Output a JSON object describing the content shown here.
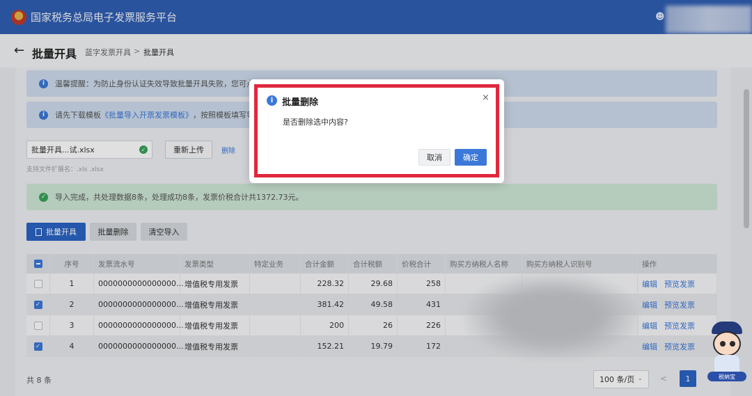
{
  "header": {
    "app_title": "国家税务总局电子发票服务平台",
    "user_icon": "user-icon"
  },
  "breadcrumb": {
    "back": "←",
    "title": "批量开具",
    "items": [
      "蓝字发票开具",
      "批量开具"
    ],
    "separator": ">"
  },
  "notices": [
    {
      "text": "温馨提醒：为防止身份认证失效导致批量开具失败，您可点"
    },
    {
      "prefix": "请先下载模板",
      "link": "《批量导入开票发票模板》",
      "suffix": "，按照模板填写导"
    }
  ],
  "upload": {
    "file_name": "批量开具...试.xlsx",
    "reupload_label": "重新上传",
    "delete_label": "删除",
    "hint": "支持文件扩展名：.xls .xlsx"
  },
  "result": {
    "text": "导入完成，共处理数据8条，处理成功8条，发票价税合计共1372.73元。"
  },
  "actions": {
    "batch_issue": "批量开具",
    "batch_delete": "批量删除",
    "clear_import": "清空导入"
  },
  "table": {
    "headers": [
      "序号",
      "发票流水号",
      "发票类型",
      "特定业务",
      "合计金额",
      "合计税额",
      "价税合计",
      "购买方纳税人名称",
      "购买方纳税人识别号",
      "操作"
    ],
    "rows": [
      {
        "checked": false,
        "no": "1",
        "serial": "0000000000000000...",
        "type": "增值税专用发票",
        "amount": "228.32",
        "tax": "29.68",
        "total": "258"
      },
      {
        "checked": true,
        "no": "2",
        "serial": "0000000000000000...",
        "type": "增值税专用发票",
        "amount": "381.42",
        "tax": "49.58",
        "total": "431"
      },
      {
        "checked": false,
        "no": "3",
        "serial": "0000000000000000...",
        "type": "增值税专用发票",
        "amount": "200",
        "tax": "26",
        "total": "226"
      },
      {
        "checked": true,
        "no": "4",
        "serial": "0000000000000000...",
        "type": "增值税专用发票",
        "amount": "152.21",
        "tax": "19.79",
        "total": "172"
      }
    ],
    "op_edit": "编辑",
    "op_preview": "预览发票"
  },
  "pagination": {
    "total": "共 8 条",
    "page_size": "100 条/页",
    "prev": "<",
    "current": "1"
  },
  "dialog": {
    "title": "批量删除",
    "message": "是否删除选中内容?",
    "cancel": "取消",
    "confirm": "确定",
    "close": "×"
  },
  "mascot": {
    "label": "税纳宝"
  },
  "colors": {
    "header_bg": "#2f5fb3",
    "primary": "#3b78d9",
    "highlight_outline": "#e0283d",
    "success": "#36a35a"
  }
}
